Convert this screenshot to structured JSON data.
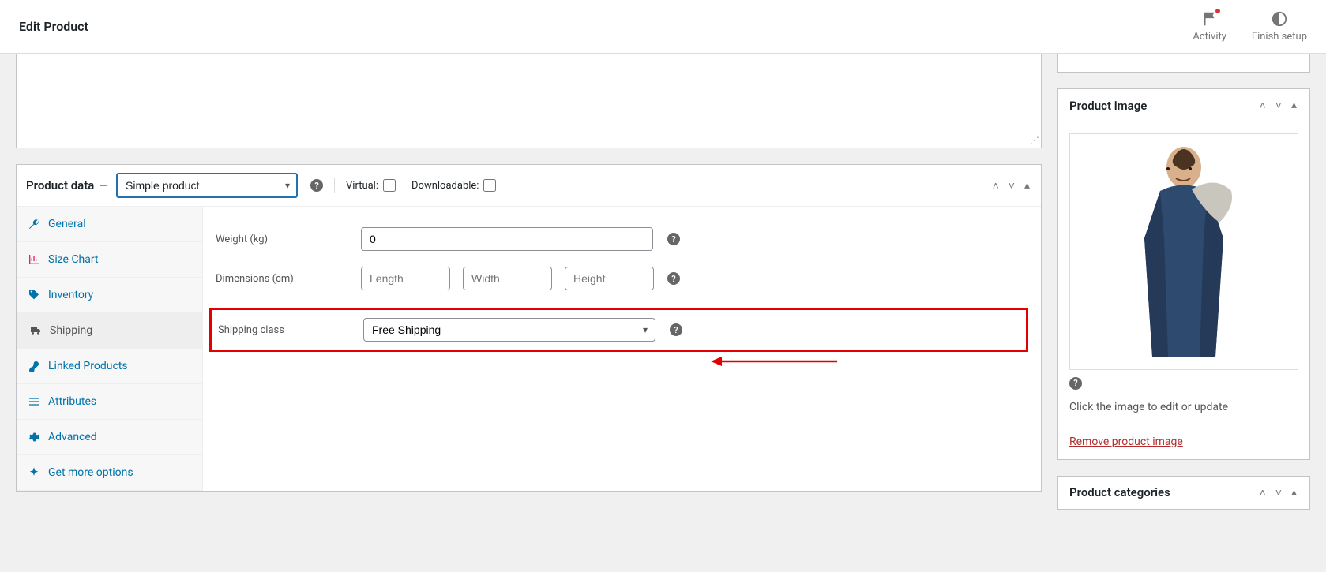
{
  "header": {
    "title": "Edit Product",
    "actions": {
      "activity": "Activity",
      "finish_setup": "Finish setup"
    }
  },
  "product_data": {
    "title": "Product data",
    "dash": "—",
    "type_select": "Simple product",
    "virtual_label": "Virtual:",
    "downloadable_label": "Downloadable:",
    "tabs": {
      "general": "General",
      "size_chart": "Size Chart",
      "inventory": "Inventory",
      "shipping": "Shipping",
      "linked": "Linked Products",
      "attributes": "Attributes",
      "advanced": "Advanced",
      "get_more": "Get more options"
    },
    "shipping_panel": {
      "weight_label": "Weight (kg)",
      "weight_value": "0",
      "dimensions_label": "Dimensions (cm)",
      "length_placeholder": "Length",
      "width_placeholder": "Width",
      "height_placeholder": "Height",
      "shipping_class_label": "Shipping class",
      "shipping_class_value": "Free Shipping"
    }
  },
  "sidebar": {
    "product_image": {
      "title": "Product image",
      "hint": "Click the image to edit or update",
      "remove": "Remove product image"
    },
    "product_categories": {
      "title": "Product categories"
    }
  }
}
